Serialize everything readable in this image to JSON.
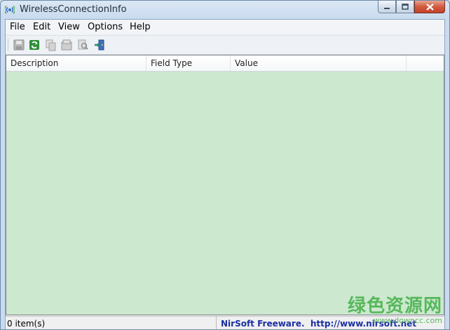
{
  "window": {
    "title": "WirelessConnectionInfo",
    "icon": "wireless-signal-icon"
  },
  "window_controls": {
    "minimize_icon": "minimize-icon",
    "maximize_icon": "maximize-icon",
    "close_icon": "close-icon"
  },
  "menu": {
    "items": [
      "File",
      "Edit",
      "View",
      "Options",
      "Help"
    ]
  },
  "toolbar": {
    "buttons": [
      {
        "icon": "save-icon",
        "enabled": false
      },
      {
        "icon": "refresh-icon",
        "enabled": true
      },
      {
        "icon": "copy-icon",
        "enabled": false
      },
      {
        "icon": "properties-icon",
        "enabled": false
      },
      {
        "icon": "find-icon",
        "enabled": false
      },
      {
        "icon": "exit-icon",
        "enabled": true
      }
    ]
  },
  "list": {
    "columns": [
      "Description",
      "Field Type",
      "Value"
    ],
    "rows": [],
    "background": "#cce8cf"
  },
  "statusbar": {
    "count": "0 item(s)",
    "credit": "NirSoft Freeware.  http://www.nirsoft.net"
  },
  "watermark": {
    "main": "绿色资源网",
    "sub": "www.downcc.com"
  }
}
